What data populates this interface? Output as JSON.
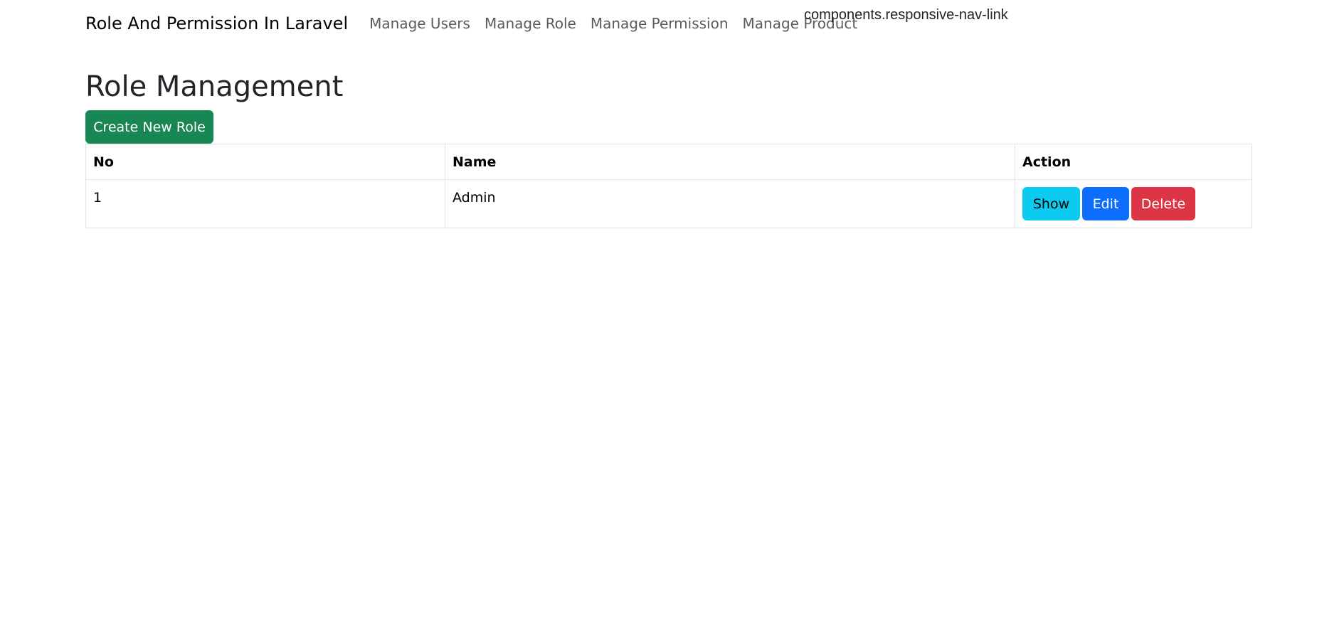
{
  "navbar": {
    "brand": "Role And Permission In Laravel",
    "links": [
      {
        "label": "Manage Users"
      },
      {
        "label": "Manage Role"
      },
      {
        "label": "Manage Permission"
      },
      {
        "label": "Manage Product"
      }
    ],
    "responsive_link": "components.responsive-nav-link"
  },
  "page": {
    "title": "Role Management",
    "create_button_label": "Create New Role"
  },
  "table": {
    "headers": [
      "No",
      "Name",
      "Action"
    ],
    "rows": [
      {
        "no": "1",
        "name": "Admin",
        "actions": {
          "show": "Show",
          "edit": "Edit",
          "delete": "Delete"
        }
      }
    ]
  },
  "colors": {
    "create": "#198754",
    "show": "#0dcaf0",
    "edit": "#0d6efd",
    "delete": "#dc3545"
  }
}
